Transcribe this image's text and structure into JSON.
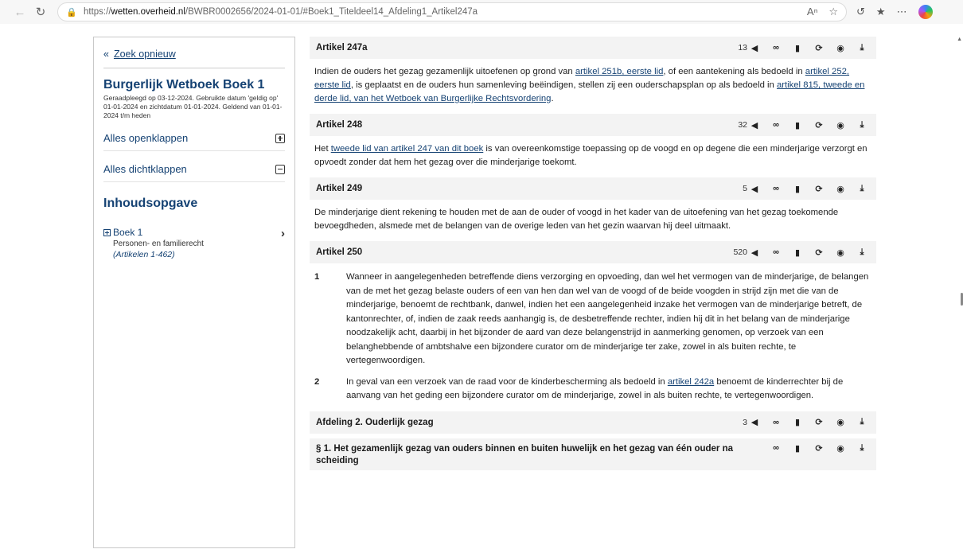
{
  "browser": {
    "url_prefix": "https://",
    "url_host": "wetten.overheid.nl",
    "url_path": "/BWBR0002656/2024-01-01/#Boek1_Titeldeel14_Afdeling1_Artikel247a"
  },
  "sidebar": {
    "zoek_label": "Zoek opnieuw",
    "law_title": "Burgerlijk Wetboek Boek 1",
    "law_meta": "Geraadpleegd op 03-12-2024. Gebruikte datum 'geldig op' 01-01-2024 en zichtdatum 01-01-2024. Geldend van 01-01-2024 t/m heden",
    "expand_all": "Alles openklappen",
    "collapse_all": "Alles dichtklappen",
    "toc_title": "Inhoudsopgave",
    "toc_book": "Boek 1",
    "toc_book_sub": "Personen- en familierecht",
    "toc_book_range": "(Artikelen 1-462)"
  },
  "articles": {
    "a247a": {
      "title": "Artikel 247a",
      "count": "13",
      "text_1": "Indien de ouders het gezag gezamenlijk uitoefenen op grond van ",
      "link_1": "artikel 251b, eerste lid",
      "text_2": ", of een aantekening als bedoeld in ",
      "link_2": "artikel 252, eerste lid",
      "text_3": ", is geplaatst en de ouders hun samenleving beëindigen, stellen zij een ouderschapsplan op als bedoeld in ",
      "link_3": "artikel 815, tweede en derde lid, van het Wetboek van Burgerlijke Rechtsvordering",
      "text_4": "."
    },
    "a248": {
      "title": "Artikel 248",
      "count": "32",
      "text_1": "Het ",
      "link_1": "tweede lid van artikel 247 van dit boek",
      "text_2": " is van overeenkomstige toepassing op de voogd en op degene die een minderjarige verzorgt en opvoedt zonder dat hem het gezag over die minderjarige toekomt."
    },
    "a249": {
      "title": "Artikel 249",
      "count": "5",
      "text": "De minderjarige dient rekening te houden met de aan de ouder of voogd in het kader van de uitoefening van het gezag toekomende bevoegdheden, alsmede met de belangen van de overige leden van het gezin waarvan hij deel uitmaakt."
    },
    "a250": {
      "title": "Artikel 250",
      "count": "520",
      "item1_num": "1",
      "item1_text": "Wanneer in aangelegenheden betreffende diens verzorging en opvoeding, dan wel het vermogen van de minderjarige, de belangen van de met het gezag belaste ouders of een van hen dan wel van de voogd of de beide voogden in strijd zijn met die van de minderjarige, benoemt de rechtbank, danwel, indien het een aangelegenheid inzake het vermogen van de minderjarige betreft, de kantonrechter, of, indien de zaak reeds aanhangig is, de desbetreffende rechter, indien hij dit in het belang van de minderjarige noodzakelijk acht, daarbij in het bijzonder de aard van deze belangenstrijd in aanmerking genomen, op verzoek van een belanghebbende of ambtshalve een bijzondere curator om de minderjarige ter zake, zowel in als buiten rechte, te vertegenwoordigen.",
      "item2_num": "2",
      "item2_text_1": "In geval van een verzoek van de raad voor de kinderbescherming als bedoeld in ",
      "item2_link": "artikel 242a",
      "item2_text_2": " benoemt de kinderrechter bij de aanvang van het geding een bijzondere curator om de minderjarige, zowel in als buiten rechte, te vertegenwoordigen."
    },
    "afd2": {
      "title": "Afdeling 2. Ouderlijk gezag",
      "count": "3"
    },
    "par1": {
      "title": "§ 1. Het gezamenlijk gezag van ouders binnen en buiten huwelijk en het gezag van één ouder na scheiding"
    }
  },
  "icons": [
    "share-icon",
    "link-icon",
    "bookmark-icon",
    "history-icon",
    "print-icon",
    "download-icon"
  ]
}
